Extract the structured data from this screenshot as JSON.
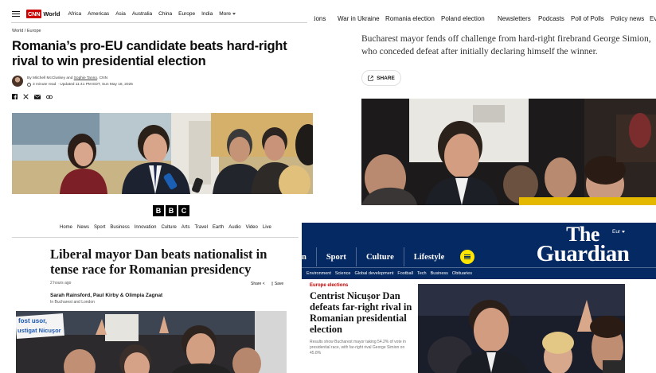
{
  "cnn": {
    "logo": "CNN",
    "section": "World",
    "nav": [
      "Africa",
      "Americas",
      "Asia",
      "Australia",
      "China",
      "Europe",
      "India"
    ],
    "more": "More",
    "breadcrumb": "World / Europe",
    "headline": "Romania’s pro-EU candidate beats hard-right rival to win presidential election",
    "byline_prefix": "By",
    "author_1": "Mitchell McCluskey",
    "byline_and": "and",
    "author_2": "Sophie Tanno",
    "byline_suffix": ", CNN",
    "read_time": "3 minute read",
    "updated": "· Updated 11:41 PM EDT, Sun May 18, 2025",
    "share_icons": [
      "facebook-icon",
      "x-icon",
      "email-icon",
      "link-icon"
    ]
  },
  "guardian_live": {
    "nav_partial": "w",
    "nav": [
      "ations",
      "War in Ukraine",
      "Romania election",
      "Poland election",
      "Newsletters",
      "Podcasts",
      "Poll of Polls",
      "Policy news",
      "Ev"
    ],
    "standfirst": "Bucharest mayor fends off challenge from hard-right firebrand George Simion, who conceded defeat after initially declaring himself the winner.",
    "share_label": "SHARE"
  },
  "bbc": {
    "logo": [
      "B",
      "B",
      "C"
    ],
    "nav": [
      "Home",
      "News",
      "Sport",
      "Business",
      "Innovation",
      "Culture",
      "Arts",
      "Travel",
      "Earth",
      "Audio",
      "Video",
      "Live"
    ],
    "headline": "Liberal mayor Dan beats nationalist in tense race for Romanian presidency",
    "timestamp": "2 hours ago",
    "share_label": "Share",
    "save_label": "Save",
    "authors": "Sarah Rainsford, Paul Kirby & Olimpia Zagnat",
    "location": "In Bucharest and London",
    "photo_sign_lines": [
      "fost usor,",
      "ustigat Nicuşor"
    ]
  },
  "guardian": {
    "edition": "Eur",
    "wordmark_the": "The",
    "wordmark_name": "Guardian",
    "pillars": [
      "n",
      "Sport",
      "Culture",
      "Lifestyle"
    ],
    "subnav": [
      "Environment",
      "Science",
      "Global development",
      "Football",
      "Tech",
      "Business",
      "Obituaries"
    ],
    "kicker": "Europe elections",
    "headline": "Centrist Nicuşor Dan defeats far-right rival in Romanian presidential election",
    "standfirst": "Results show Bucharest mayor taking 54.2% of vote in presidential race, with far-right rival George Simion on 45.8%"
  }
}
